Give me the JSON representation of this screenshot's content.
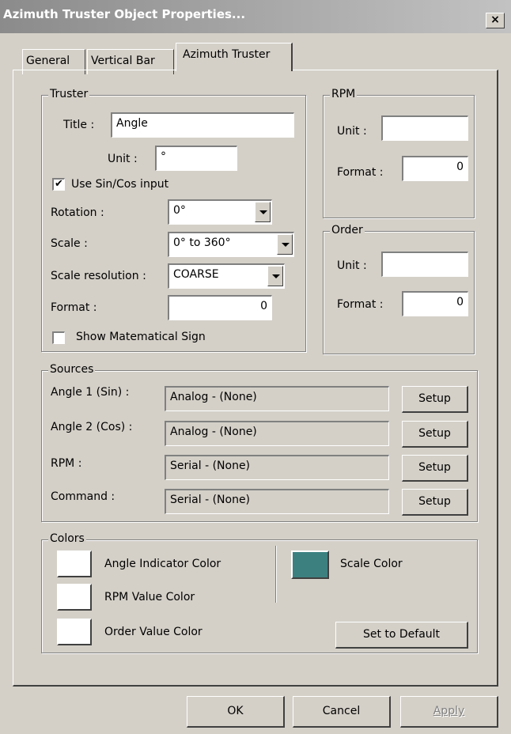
{
  "window": {
    "title": "Azimuth Truster Object Properties...",
    "close_glyph": "×"
  },
  "tabs": [
    {
      "label": "General"
    },
    {
      "label": "Vertical Bar"
    },
    {
      "label": "Azimuth Truster"
    }
  ],
  "truster": {
    "legend": "Truster",
    "title_label": "Title :",
    "title_value": "Angle",
    "unit_label": "Unit :",
    "unit_value": "°",
    "use_sincos_label": "Use Sin/Cos input",
    "use_sincos_checked": "✔",
    "rotation_label": "Rotation :",
    "rotation_value": "0°",
    "scale_label": "Scale :",
    "scale_value": "0° to 360°",
    "scale_res_label": "Scale resolution :",
    "scale_res_value": "COARSE",
    "format_label": "Format :",
    "format_value": "0",
    "show_sign_label": "Show Matematical Sign",
    "show_sign_checked": ""
  },
  "rpm": {
    "legend": "RPM",
    "unit_label": "Unit :",
    "unit_value": "",
    "format_label": "Format :",
    "format_value": "0"
  },
  "order": {
    "legend": "Order",
    "unit_label": "Unit :",
    "unit_value": "",
    "format_label": "Format :",
    "format_value": "0"
  },
  "sources": {
    "legend": "Sources",
    "rows": [
      {
        "label": "Angle 1 (Sin) :",
        "value": "Analog - (None)",
        "button": "Setup"
      },
      {
        "label": "Angle 2 (Cos) :",
        "value": "Analog - (None)",
        "button": "Setup"
      },
      {
        "label": "RPM :",
        "value": "Serial - (None)",
        "button": "Setup"
      },
      {
        "label": "Command :",
        "value": "Serial - (None)",
        "button": "Setup"
      }
    ]
  },
  "colors": {
    "legend": "Colors",
    "angle_indicator_label": "Angle Indicator Color",
    "angle_indicator_color": "#ffffff",
    "rpm_value_label": "RPM Value Color",
    "rpm_value_color": "#ffffff",
    "order_value_label": "Order Value Color",
    "order_value_color": "#ffffff",
    "scale_label": "Scale Color",
    "scale_color": "#3c8080",
    "set_default_label": "Set to Default"
  },
  "footer": {
    "ok_label": "OK",
    "cancel_label": "Cancel",
    "apply_label": "Apply"
  }
}
